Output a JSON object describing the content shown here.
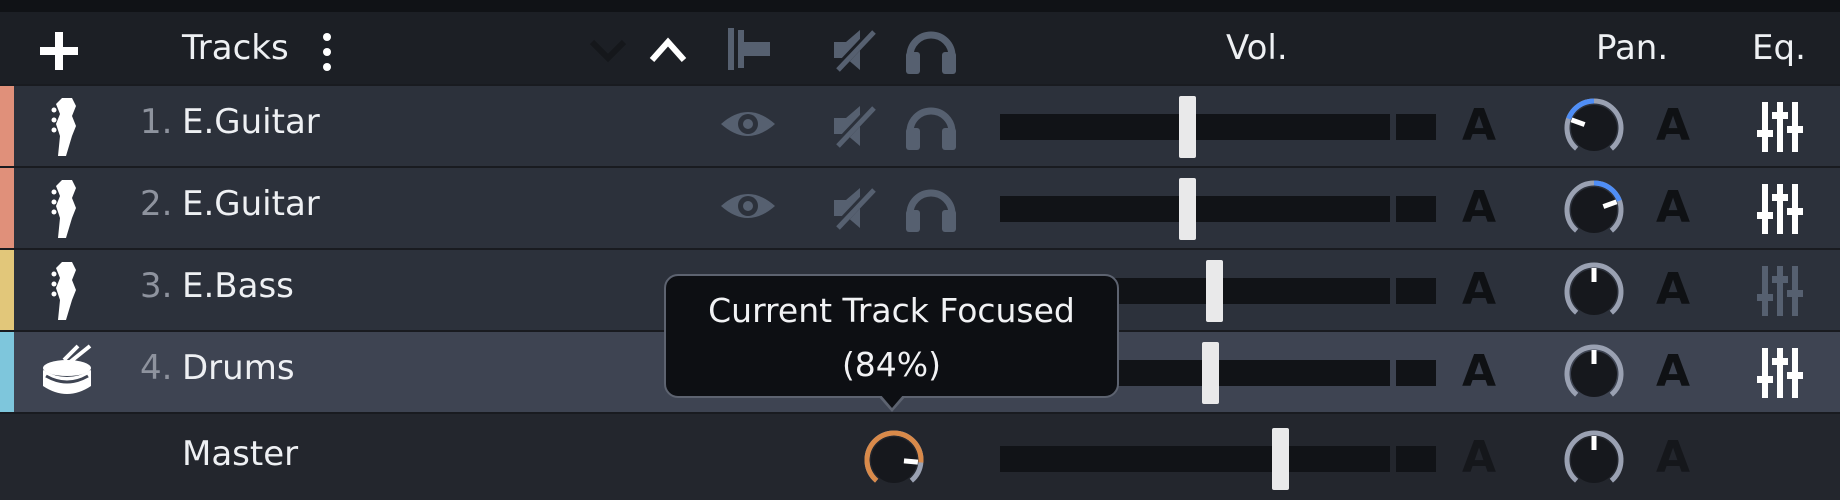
{
  "header": {
    "title": "Tracks",
    "vol_label": "Vol.",
    "pan_label": "Pan.",
    "eq_label": "Eq."
  },
  "tracks": [
    {
      "number": "1.",
      "name": "E.Guitar",
      "color": "#e0907a",
      "icon": "electric-guitar-icon",
      "volume": 0.48,
      "pan": -0.5
    },
    {
      "number": "2.",
      "name": "E.Guitar",
      "color": "#e0907a",
      "icon": "electric-guitar-icon",
      "volume": 0.48,
      "pan": 0.5
    },
    {
      "number": "3.",
      "name": "E.Bass",
      "color": "#e2c77a",
      "icon": "electric-bass-icon",
      "volume": 0.55,
      "pan": 0
    },
    {
      "number": "4.",
      "name": "Drums",
      "color": "#7ec6dc",
      "icon": "drum-icon",
      "volume": 0.54,
      "pan": 0
    }
  ],
  "master": {
    "name": "Master",
    "volume": 0.72,
    "focus_knob": 0.84
  },
  "automation_label": "A",
  "tooltip": {
    "line1": "Current Track Focused",
    "line2": "(84%)"
  },
  "colors": {
    "knob_blue": "#4f8ef7",
    "knob_orange": "#d98a4a"
  }
}
